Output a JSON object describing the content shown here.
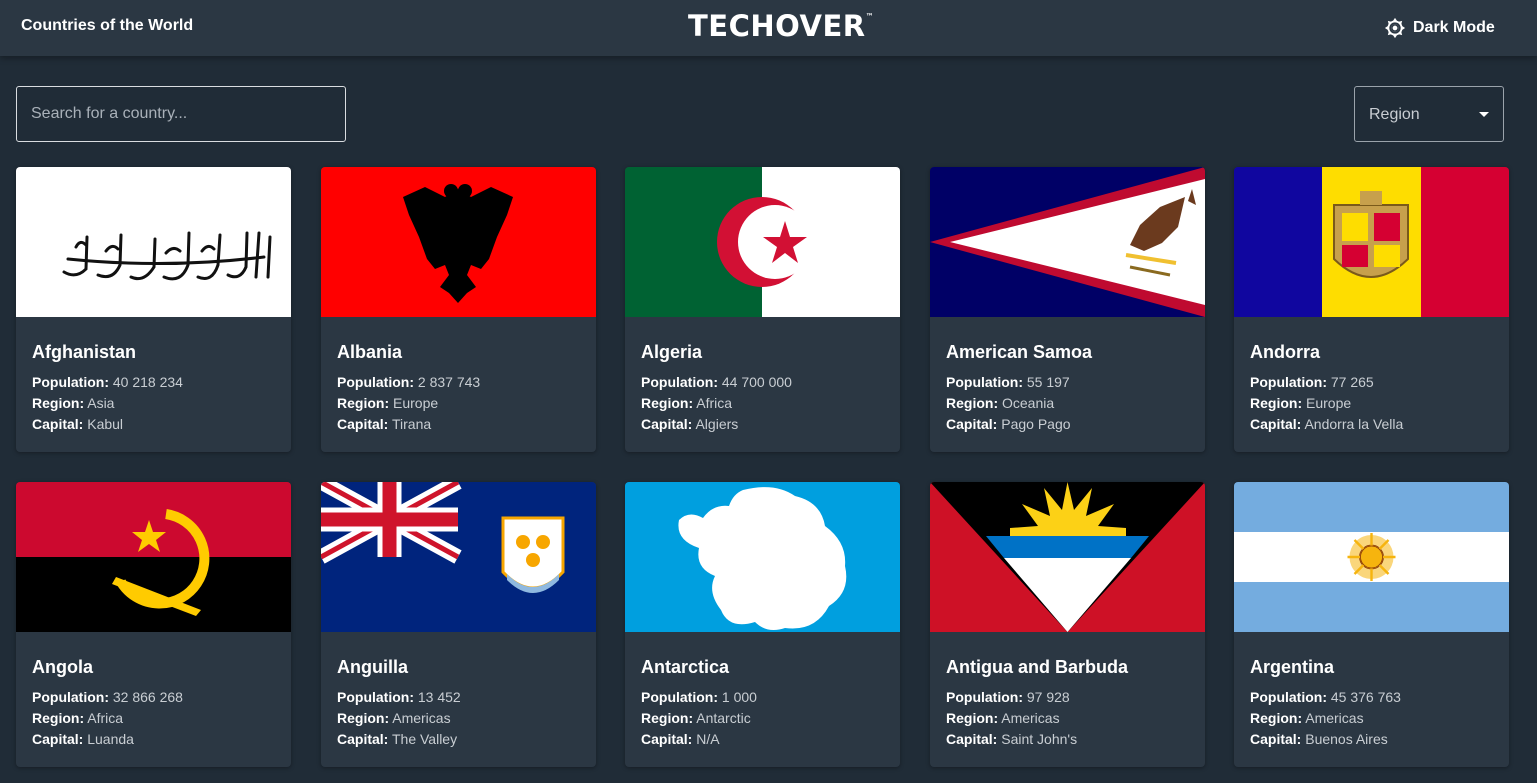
{
  "header": {
    "site_title": "Countries of the World",
    "brand": "TECHOVER",
    "brand_mark": "™",
    "mode_toggle_label": "Dark Mode",
    "mode_icon": "sun-icon"
  },
  "controls": {
    "search_placeholder": "Search for a country...",
    "search_value": "",
    "region_selected": "Region"
  },
  "field_labels": {
    "population": "Population:",
    "region": "Region:",
    "capital": "Capital:"
  },
  "colors": {
    "background": "#202c37",
    "card": "#2b3743",
    "text": "#ffffff"
  },
  "countries": [
    {
      "name": "Afghanistan",
      "population": "40 218 234",
      "region": "Asia",
      "capital": "Kabul",
      "flag": "afghanistan-flag"
    },
    {
      "name": "Albania",
      "population": "2 837 743",
      "region": "Europe",
      "capital": "Tirana",
      "flag": "albania-flag"
    },
    {
      "name": "Algeria",
      "population": "44 700 000",
      "region": "Africa",
      "capital": "Algiers",
      "flag": "algeria-flag"
    },
    {
      "name": "American Samoa",
      "population": "55 197",
      "region": "Oceania",
      "capital": "Pago Pago",
      "flag": "american-samoa-flag"
    },
    {
      "name": "Andorra",
      "population": "77 265",
      "region": "Europe",
      "capital": "Andorra la Vella",
      "flag": "andorra-flag"
    },
    {
      "name": "Angola",
      "population": "32 866 268",
      "region": "Africa",
      "capital": "Luanda",
      "flag": "angola-flag"
    },
    {
      "name": "Anguilla",
      "population": "13 452",
      "region": "Americas",
      "capital": "The Valley",
      "flag": "anguilla-flag"
    },
    {
      "name": "Antarctica",
      "population": "1 000",
      "region": "Antarctic",
      "capital": "N/A",
      "flag": "antarctica-flag"
    },
    {
      "name": "Antigua and Barbuda",
      "population": "97 928",
      "region": "Americas",
      "capital": "Saint John's",
      "flag": "antigua-and-barbuda-flag"
    },
    {
      "name": "Argentina",
      "population": "45 376 763",
      "region": "Americas",
      "capital": "Buenos Aires",
      "flag": "argentina-flag"
    }
  ]
}
